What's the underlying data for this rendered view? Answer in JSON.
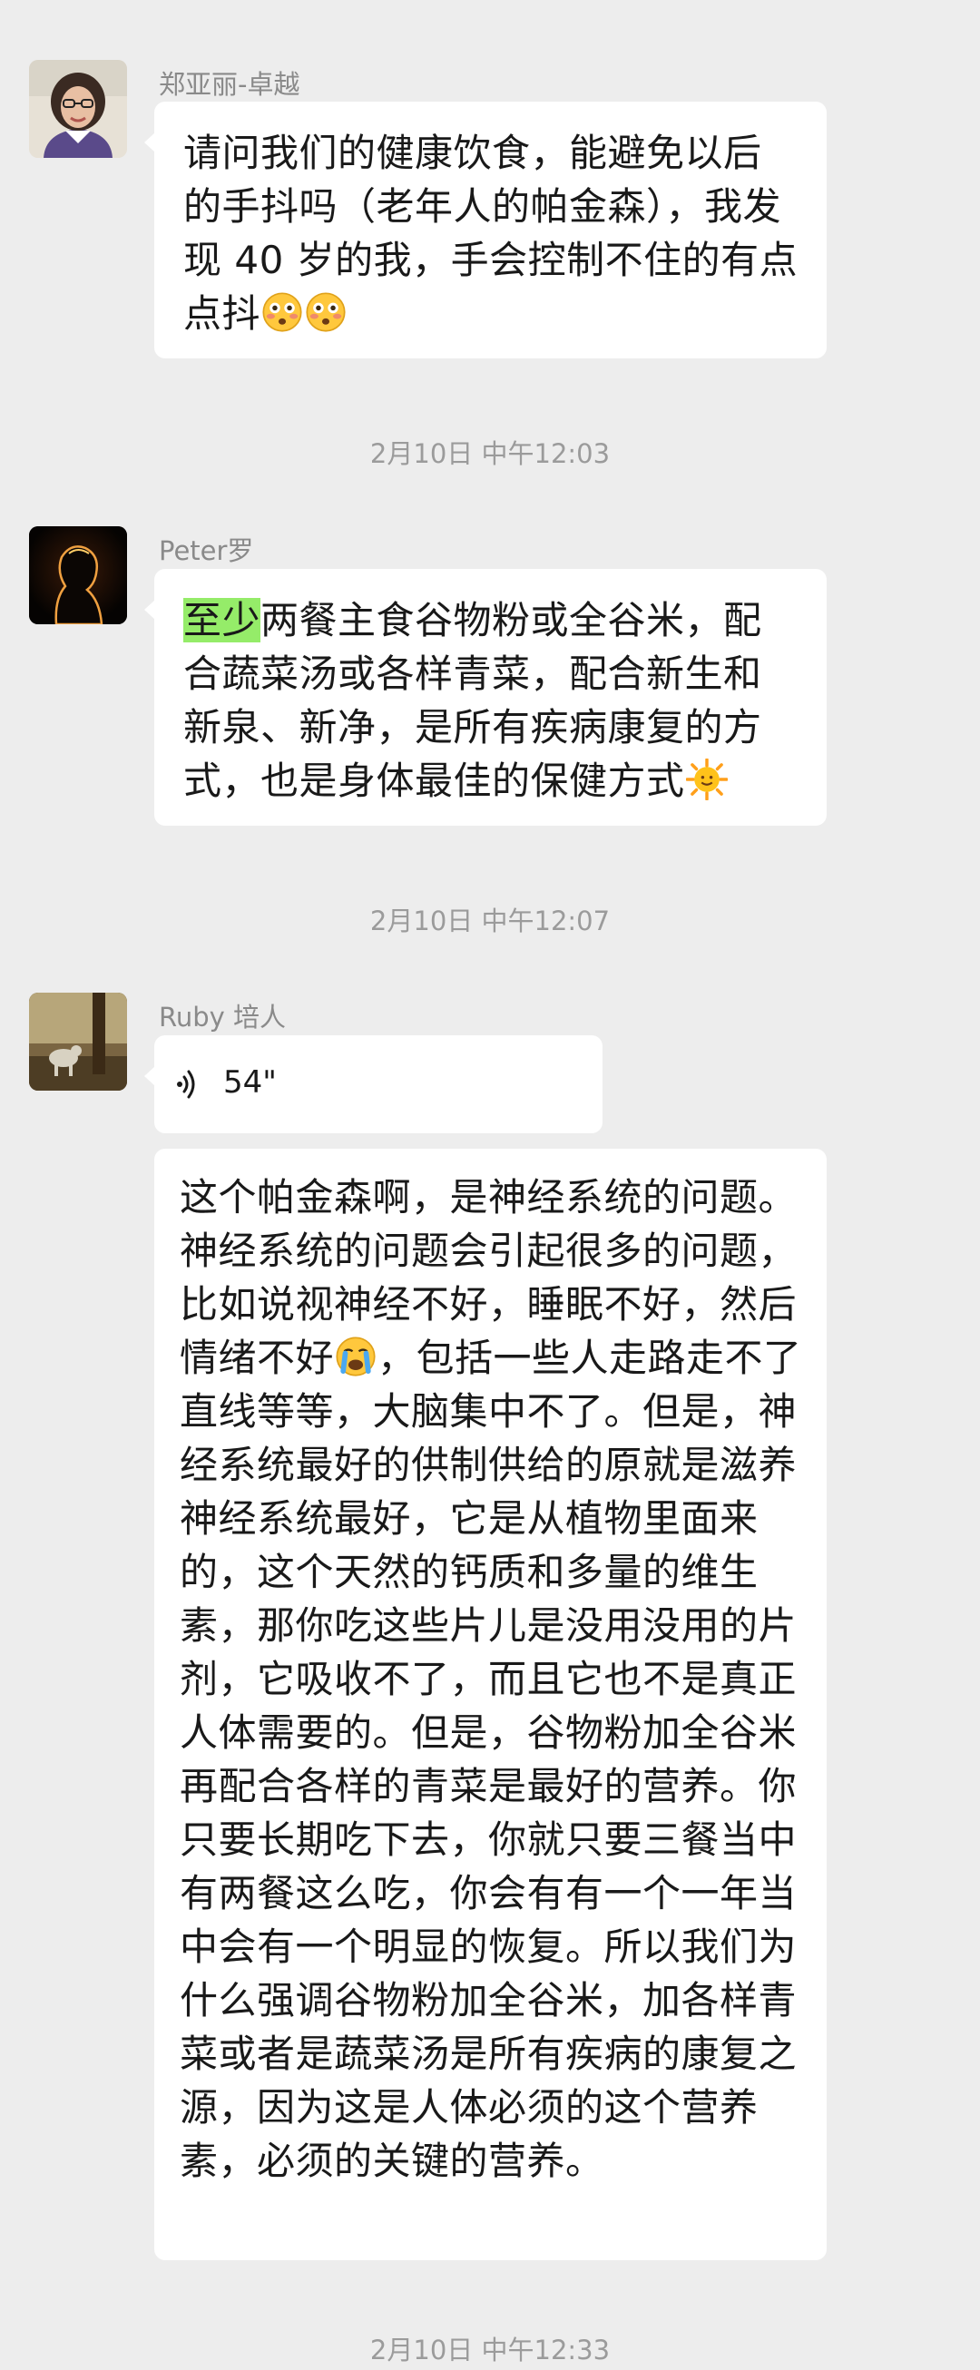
{
  "messages": [
    {
      "sender": "郑亚丽-卓越",
      "text": "请问我们的健康饮食，能避免以后的手抖吗（老年人的帕金森），我发现 40 岁的我，手会控制不住的有点点抖",
      "emojis": [
        "flushed-face-icon",
        "flushed-face-icon"
      ]
    },
    {
      "timestamp": "2月10日 中午12:03"
    },
    {
      "sender": "Peter罗",
      "highlight": "至少",
      "text": "两餐主食谷物粉或全谷米，配合蔬菜汤或各样青菜，配合新生和新泉、新净，是所有疾病康复的方式，也是身体最佳的保健方式",
      "emojis": [
        "sun-face-icon"
      ]
    },
    {
      "timestamp": "2月10日 中午12:07"
    },
    {
      "sender": "Ruby 培人",
      "voice_duration": "54\"",
      "text_part1": "这个帕金森啊，是神经系统的问题。神经系统的问题会引起很多的问题，比如说视神经不好，睡眠不好，然后情绪不好",
      "emojis": [
        "crying-face-icon"
      ],
      "text_part2": "，包括一些人走路走不了直线等等，大脑集中不了。但是，神经系统最好的供制供给的原就是滋养神经系统最好，它是从植物里面来的，这个天然的钙质和多量的维生素，那你吃这些片儿是没用没用的片剂，它吸收不了，而且它也不是真正人体需要的。但是，谷物粉加全谷米再配合各样的青菜是最好的营养。你只要长期吃下去，你就只要三餐当中有两餐这么吃，你会有有一个一年当中会有一个明显的恢复。所以我们为什么强调谷物粉加全谷米，加各样青菜或者是蔬菜汤是所有疾病的康复之源，因为这是人体必须的这个营养素，必须的关键的营养。"
    },
    {
      "timestamp": "2月10日 中午12:33"
    }
  ],
  "colors": {
    "background": "#ededed",
    "bubble": "#ffffff",
    "highlight": "#95ec69",
    "meta_text": "#8a8a8a"
  }
}
